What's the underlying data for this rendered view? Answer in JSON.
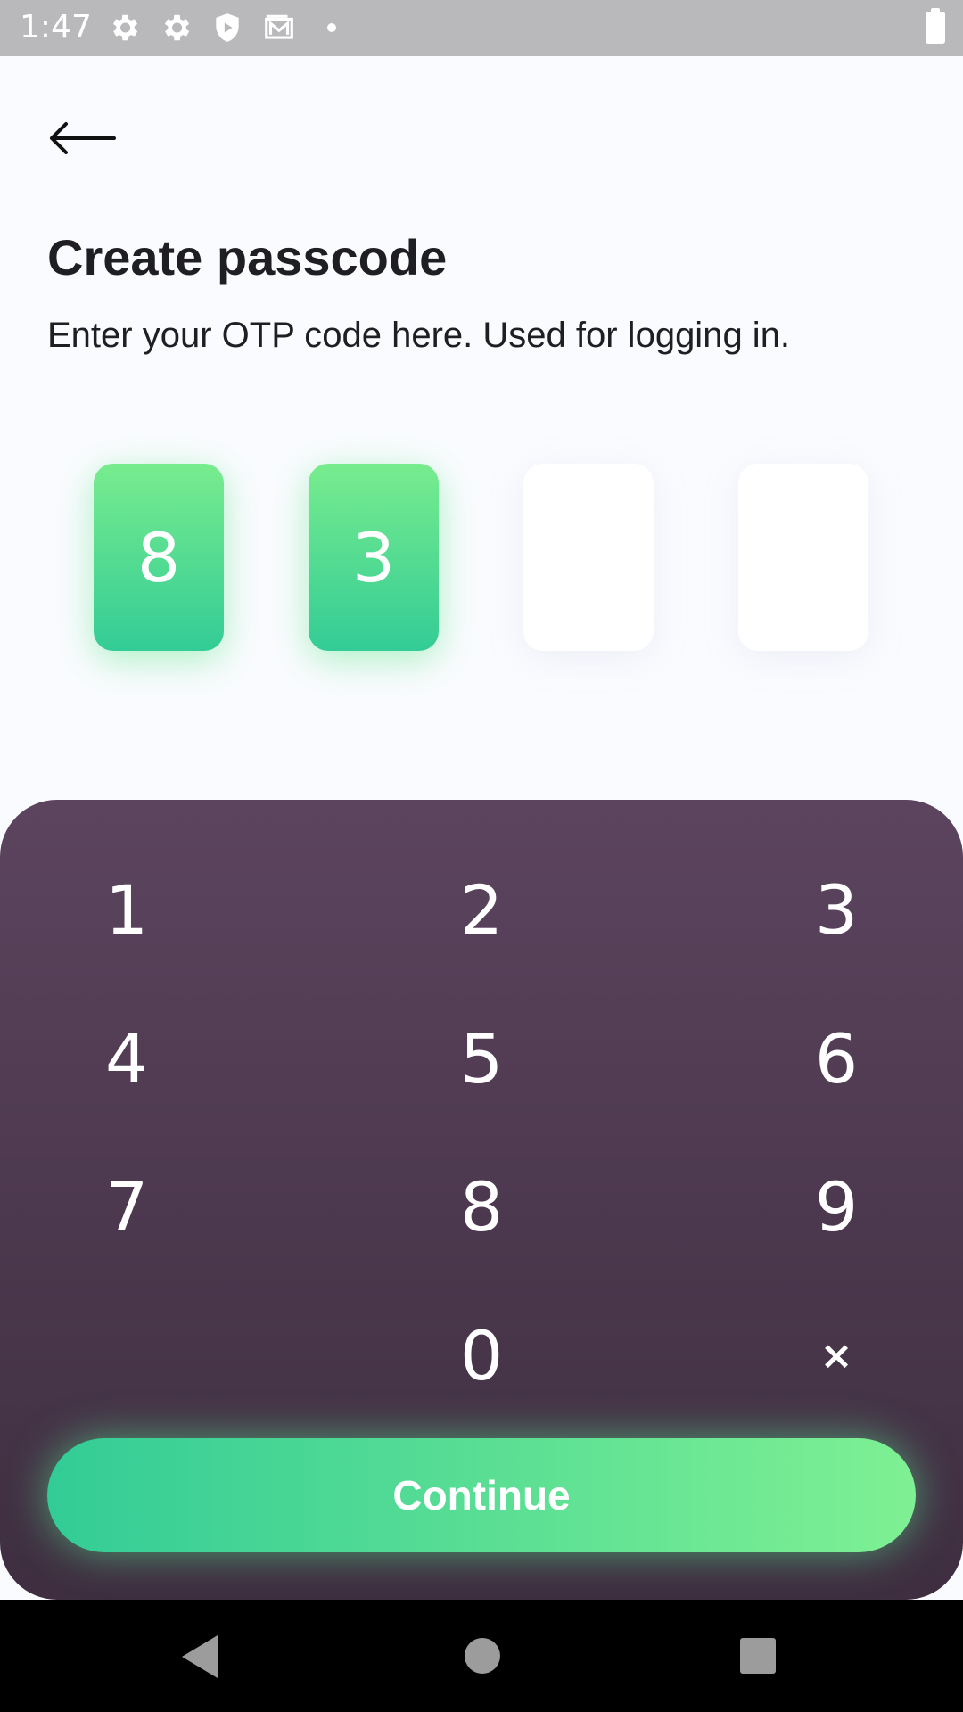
{
  "status_bar": {
    "time": "1:47",
    "icons": [
      "settings-icon",
      "settings-icon",
      "shield-play-icon",
      "mail-icon",
      "notification-dot-icon",
      "battery-icon"
    ]
  },
  "header": {
    "back_icon": "arrow-left-icon",
    "title": "Create passcode",
    "subtitle": "Enter your OTP code here. Used for logging in."
  },
  "otp": {
    "length": 4,
    "digits": [
      "8",
      "3",
      "",
      ""
    ]
  },
  "keypad": {
    "keys": [
      "1",
      "2",
      "3",
      "4",
      "5",
      "6",
      "7",
      "8",
      "9",
      "0"
    ],
    "delete_label": "×",
    "continue_label": "Continue"
  },
  "nav_bar": {
    "icons": [
      "back-triangle-icon",
      "home-circle-icon",
      "recents-square-icon"
    ]
  },
  "colors": {
    "accent_start": "#33cc96",
    "accent_end": "#7ff093",
    "keypad_top": "#5c445e",
    "keypad_bottom": "#3e2e40",
    "background": "#fafbfe",
    "text_primary": "#1f1f23"
  }
}
